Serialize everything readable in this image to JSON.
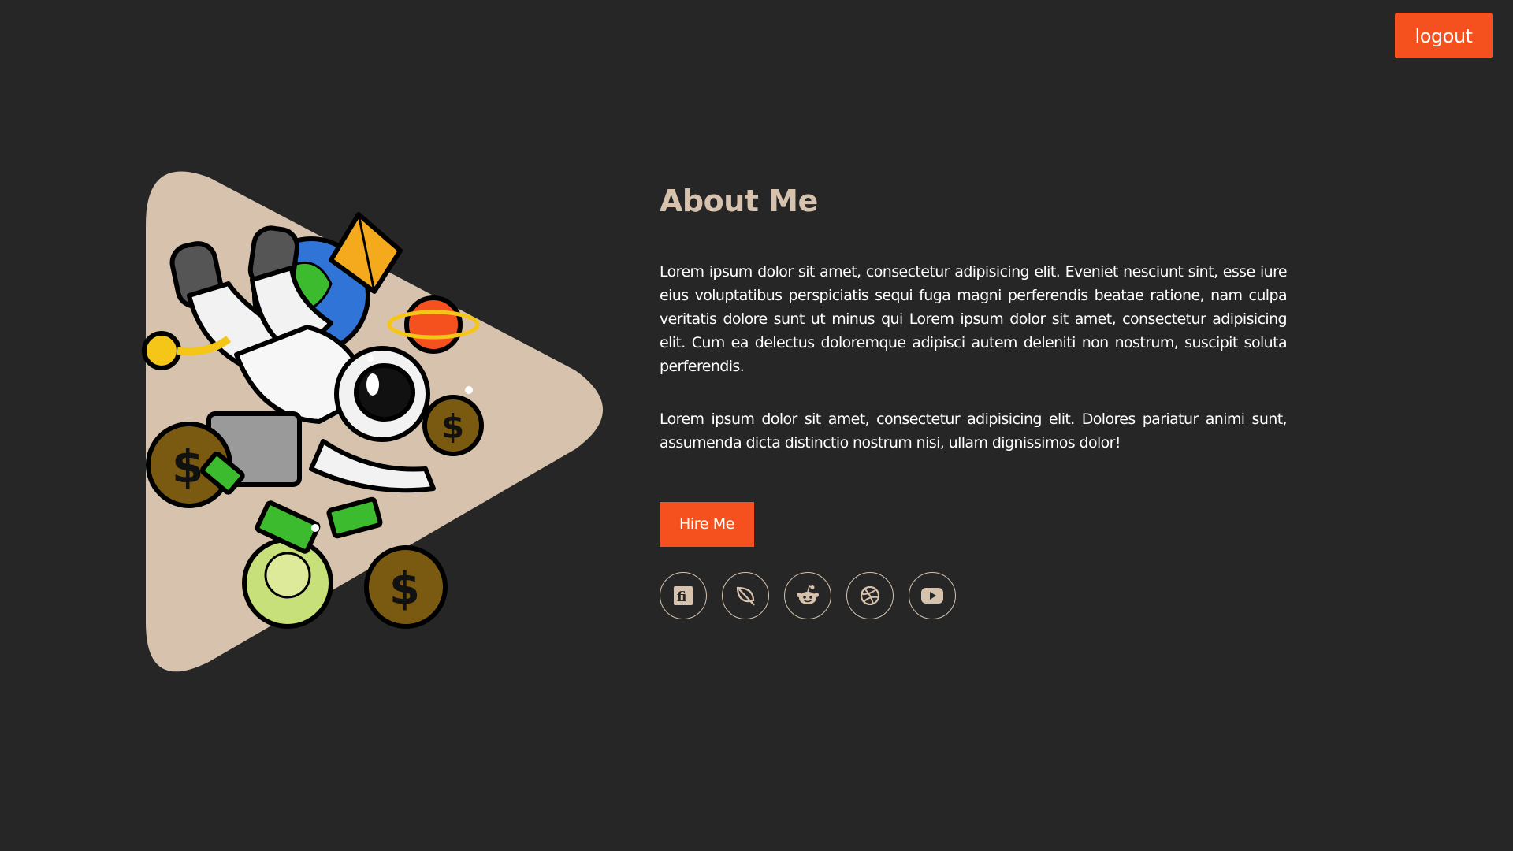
{
  "header": {
    "logout_label": "logout"
  },
  "hero": {
    "image_alt": "astronaut-with-money-illustration"
  },
  "about": {
    "title": "About Me",
    "paragraphs": [
      "Lorem ipsum dolor sit amet, consectetur adipisicing elit. Eveniet nesciunt sint, esse iure eius voluptatibus perspiciatis sequi fuga magni perferendis beatae ratione, nam culpa veritatis dolore sunt ut minus qui Lorem ipsum dolor sit amet, consectetur adipisicing elit. Cum ea delectus doloremque adipisci autem deleniti non nostrum, suscipit soluta perferendis.",
      "Lorem ipsum dolor sit amet, consectetur adipisicing elit. Dolores pariatur animi sunt, assumenda dicta distinctio nostrum nisi, ullam dignissimos dolor!"
    ],
    "hire_label": "Hire Me"
  },
  "socials": [
    {
      "icon": "fiverr-icon"
    },
    {
      "icon": "leaf-icon"
    },
    {
      "icon": "reddit-icon"
    },
    {
      "icon": "dribbble-icon"
    },
    {
      "icon": "youtube-icon"
    }
  ],
  "colors": {
    "background": "#262626",
    "accent": "#f4511e",
    "beige": "#d7c3ad",
    "text": "#ffffff"
  }
}
